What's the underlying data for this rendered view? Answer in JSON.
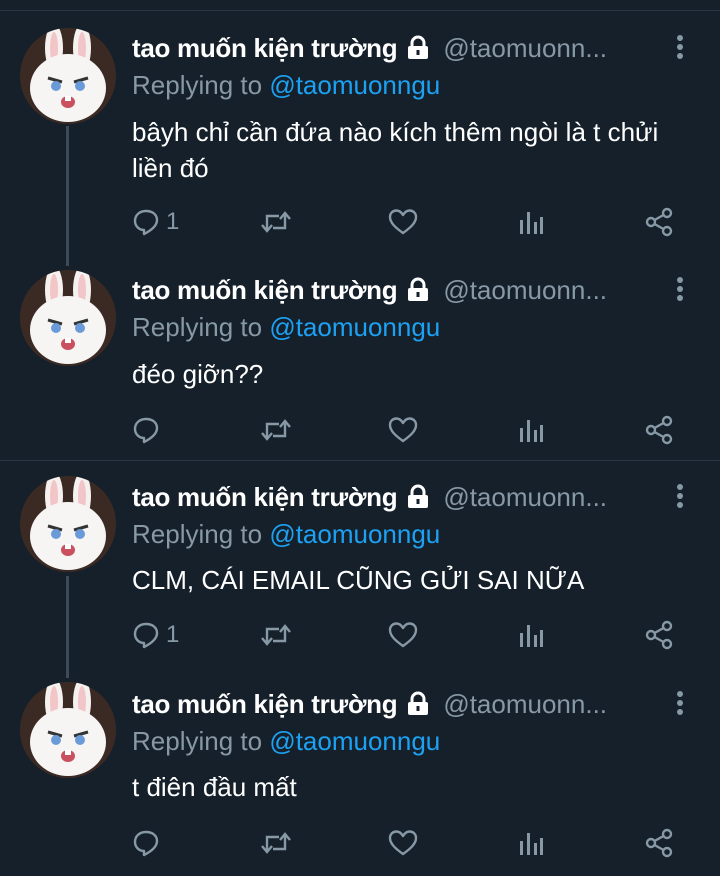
{
  "user": {
    "name": "tao muốn kiện trường",
    "handle": "@taomuonn...",
    "reply_prefix": "Replying to",
    "reply_to": "@taomuonngu"
  },
  "tweets": [
    {
      "text": "bâyh chỉ cần đứa nào kích thêm ngòi là t chửi liền đó",
      "reply_count": "1"
    },
    {
      "text": "đéo giỡn??",
      "reply_count": ""
    },
    {
      "text": "CLM, CÁI EMAIL CŨNG GỬI SAI NỮA",
      "reply_count": "1"
    },
    {
      "text": "t điên đầu mất",
      "reply_count": ""
    }
  ],
  "icons": {
    "avatar": "white-rabbit-avatar",
    "lock": "lock-icon",
    "more": "more-vertical-icon",
    "reply": "reply-icon",
    "retweet": "retweet-icon",
    "like": "heart-icon",
    "analytics": "analytics-icon",
    "share": "share-icon"
  },
  "colors": {
    "background": "#15202b",
    "secondary_text": "#8899a6",
    "mention": "#1da1f2",
    "divider": "#2a3642"
  }
}
